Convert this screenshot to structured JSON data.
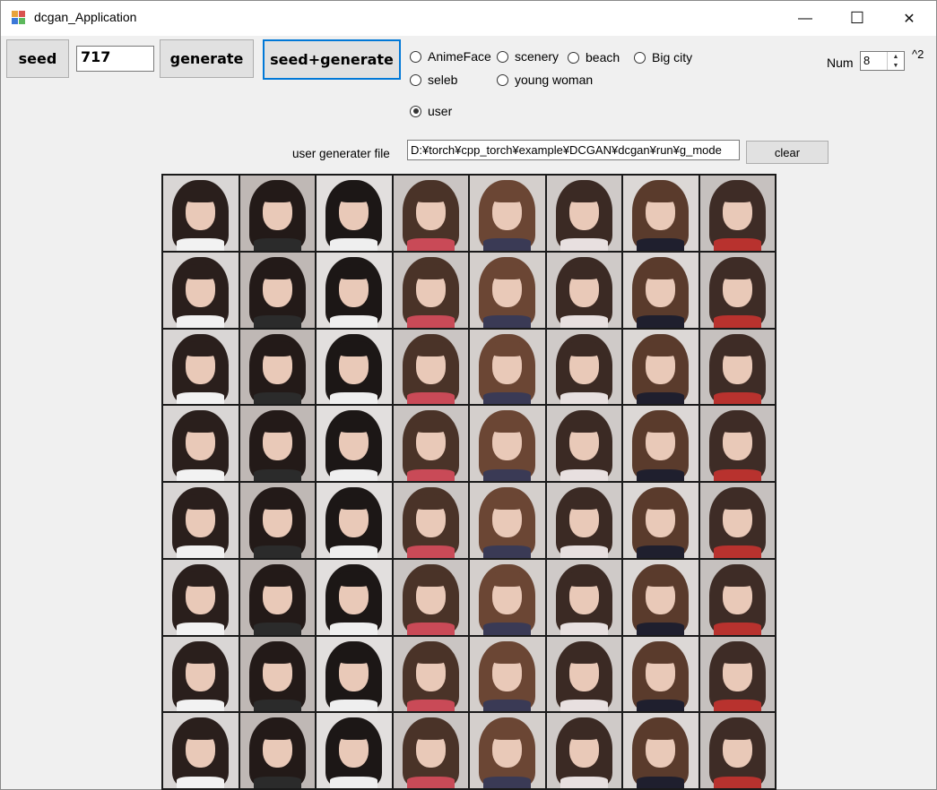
{
  "window": {
    "title": "dcgan_Application",
    "minimize_glyph": "—",
    "maximize_glyph": "☐",
    "close_glyph": "✕"
  },
  "toolbar": {
    "seed_label": "seed",
    "seed_value": "717",
    "generate_label": "generate",
    "seed_generate_label": "seed+generate"
  },
  "models": {
    "options": [
      {
        "label": "AnimeFace",
        "selected": false
      },
      {
        "label": "scenery",
        "selected": false
      },
      {
        "label": "beach",
        "selected": false
      },
      {
        "label": "Big city",
        "selected": false
      },
      {
        "label": "seleb",
        "selected": false
      },
      {
        "label": "young woman",
        "selected": false
      },
      {
        "label": "user",
        "selected": true
      }
    ]
  },
  "num": {
    "label": "Num",
    "value": "8",
    "exponent": "^2"
  },
  "generator_file": {
    "label": "user generater file",
    "path": "D:¥torch¥cpp_torch¥example¥DCGAN¥dcgan¥run¥g_mode",
    "clear_label": "clear"
  },
  "output": {
    "rows": 8,
    "cols": 8
  }
}
